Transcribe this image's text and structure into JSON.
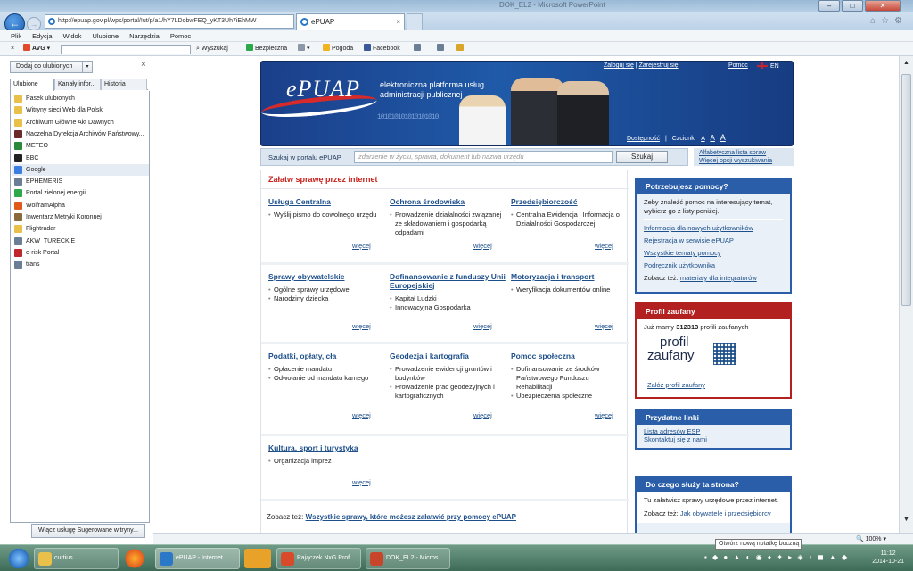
{
  "window": {
    "title": "DOK_EL2 - Microsoft PowerPoint"
  },
  "browser": {
    "url": "http://epuap.gov.pl/wps/portal/!ut/p/a1/hY7LDobwFEQ_yKT3Uh7iEhMW",
    "tab_title": "ePUAP",
    "menu": [
      "Plik",
      "Edycja",
      "Widok",
      "Ulubione",
      "Narzędzia",
      "Pomoc"
    ],
    "toolbar": {
      "avg": "AVG",
      "search_btn": "Wyszukaj",
      "safe": "Bezpieczna",
      "weather": "Pogoda",
      "facebook": "Facebook"
    },
    "zoom": "100%"
  },
  "favorites": {
    "add_btn": "Dodaj do ulubionych",
    "tabs": [
      "Ulubione",
      "Kanały infor...",
      "Historia"
    ],
    "items": [
      {
        "label": "Pasek ulubionych",
        "icon": "folder-icon",
        "color": "#e8c04a"
      },
      {
        "label": "Witryny sieci Web dla Polski",
        "icon": "folder-icon",
        "color": "#e8c04a"
      },
      {
        "label": "Archiwum Główne Akt Dawnych",
        "icon": "folder-icon",
        "color": "#e8c04a"
      },
      {
        "label": "Naczelna Dyrekcja Archiwów Państwowy...",
        "icon": "archive-icon",
        "color": "#6b2a2a"
      },
      {
        "label": "METEO",
        "icon": "icm-icon",
        "color": "#2a8a3a"
      },
      {
        "label": "BBC",
        "icon": "bbc-icon",
        "color": "#222222"
      },
      {
        "label": "Google",
        "icon": "google-icon",
        "color": "#3b7de0"
      },
      {
        "label": "EPHEMERIS",
        "icon": "page-icon",
        "color": "#6a7f96"
      },
      {
        "label": "Portal zielonej energii",
        "icon": "power-icon",
        "color": "#2da84a"
      },
      {
        "label": "WolframAlpha",
        "icon": "wolfram-icon",
        "color": "#e05a1c"
      },
      {
        "label": "Inwentarz Metryki Koronnej",
        "icon": "page-icon",
        "color": "#8a6a3a"
      },
      {
        "label": "Flightradar",
        "icon": "folder-icon",
        "color": "#e8c04a"
      },
      {
        "label": "AKW_TURECKIE",
        "icon": "page-icon",
        "color": "#6a7f96"
      },
      {
        "label": "e-risk Portal",
        "icon": "erisk-icon",
        "color": "#c0262d"
      },
      {
        "label": "trans",
        "icon": "page-icon",
        "color": "#6a7f96"
      }
    ],
    "selected_index": 6,
    "suggest_btn": "Włącz usługę Sugerowane witryny..."
  },
  "epuap": {
    "logo": "ePUAP",
    "tagline": "elektroniczna platforma usług administracji publicznej",
    "binary": "101010101010101010",
    "login": "Zaloguj się",
    "register": "Zarejestruj się",
    "help": "Pomoc",
    "lang": "EN",
    "a11y": "Dostępność",
    "font": "Czcionki",
    "a1": "A",
    "a2": "A",
    "a3": "A",
    "search_label": "Szukaj w portalu ePUAP",
    "search_placeholder": "zdarzenie w życiu, sprawa, dokument lub nazwa urzędu",
    "search_btn": "Szukaj",
    "alpha_list": "Alfabetyczna lista spraw",
    "more_search": "Więcej opcji wyszukiwania",
    "main_title": "Załatw sprawę przez internet",
    "more": "więcej",
    "categories": [
      {
        "title": "Usługa Centralna",
        "items": [
          "Wyślij pismo do dowolnego urzędu"
        ]
      },
      {
        "title": "Ochrona środowiska",
        "items": [
          "Prowadzenie działalności związanej ze składowaniem i gospodarką odpadami"
        ]
      },
      {
        "title": "Przedsiębiorczość",
        "items": [
          "Centralna Ewidencja i Informacja o Działalności Gospodarczej"
        ]
      },
      {
        "title": "Sprawy obywatelskie",
        "items": [
          "Ogólne sprawy urzędowe",
          "Narodziny dziecka"
        ]
      },
      {
        "title": "Dofinansowanie z funduszy Unii Europejskiej",
        "items": [
          "Kapitał Ludzki",
          "Innowacyjna Gospodarka"
        ]
      },
      {
        "title": "Motoryzacja i transport",
        "items": [
          "Weryfikacja dokumentów online"
        ]
      },
      {
        "title": "Podatki, opłaty, cła",
        "items": [
          "Opłacenie mandatu",
          "Odwołanie od mandatu karnego"
        ]
      },
      {
        "title": "Geodezja i kartografia",
        "items": [
          "Prowadzenie ewidencji gruntów i budynków",
          "Prowadzenie prac geodezyjnych i kartograficznych"
        ]
      },
      {
        "title": "Pomoc społeczna",
        "items": [
          "Dofinansowanie ze środków Państwowego Funduszu Rehabilitacji",
          "Ubezpieczenia społeczne"
        ]
      },
      {
        "title": "Kultura, sport i turystyka",
        "items": [
          "Organizacja imprez"
        ]
      }
    ],
    "also_label": "Zobacz też:",
    "also_link": "Wszystkie sprawy, które możesz załatwić przy pomocy ePUAP",
    "help_box": {
      "title": "Potrzebujesz pomocy?",
      "intro": "Żeby znaleźć pomoc na interesujący temat, wybierz go z listy poniżej.",
      "links": [
        "Informacja dla nowych użytkowników",
        "Rejestracja w serwisie ePUAP",
        "Wszystkie tematy pomocy",
        "Podręcznik użytkownika"
      ],
      "see_label": "Zobacz też:",
      "see_link": "materiały dla integratorów"
    },
    "pz_box": {
      "title": "Profil zaufany",
      "count_pre": "Już mamy",
      "count": "312313",
      "count_post": "profili zaufanych",
      "logo1": "profil",
      "logo2": "zaufany",
      "link": "Załóż profil zaufany"
    },
    "links_box": {
      "title": "Przydatne linki",
      "links": [
        "Lista adresów ESP",
        "Skontaktuj się z nami"
      ]
    },
    "purpose_box": {
      "title": "Do czego służy ta strona?",
      "text": "Tu załatwisz sprawy urzędowe przez internet.",
      "see_label": "Zobacz też:",
      "see_link": "Jak obywatele i przedsiębiorcy"
    }
  },
  "taskbar": {
    "items": [
      "curtius",
      "ePUAP - Internet ...",
      "Pajączek NxG Prof...",
      "DOK_EL2 - Micros..."
    ],
    "time": "11:12",
    "date": "2014-10-21",
    "tooltip": "Otwórz nową notatkę boczną"
  }
}
